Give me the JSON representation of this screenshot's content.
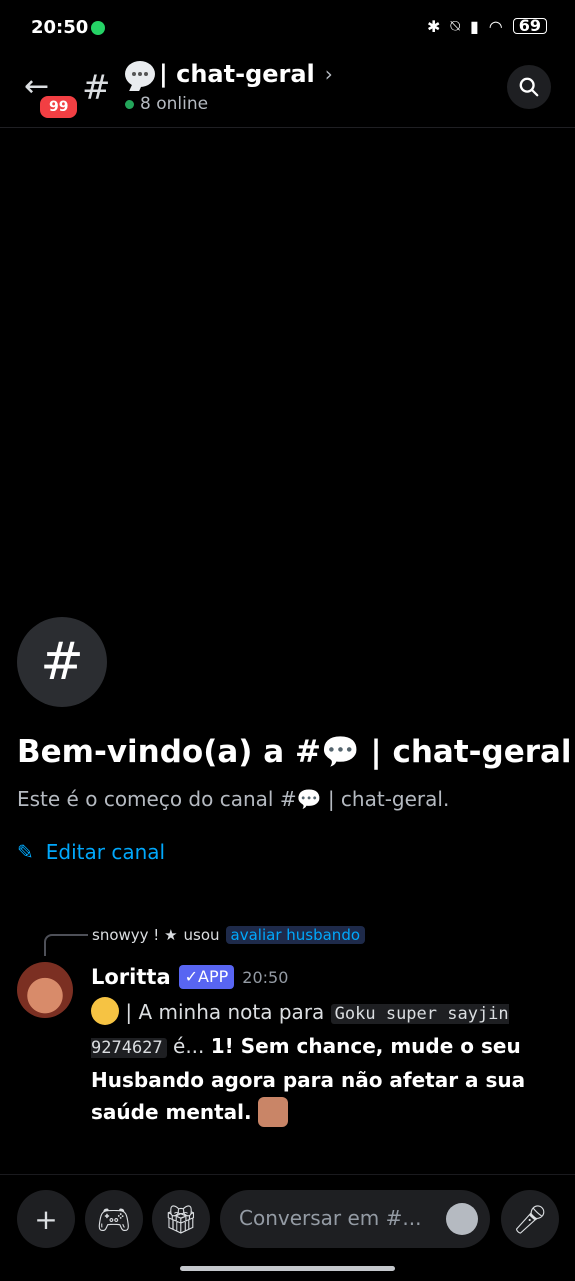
{
  "status_bar": {
    "time": "20:50",
    "battery": "69"
  },
  "header": {
    "back_badge": "99",
    "hash": "#",
    "channel_name": "| chat-geral",
    "online": "8 online"
  },
  "welcome": {
    "icon": "#",
    "title": "Bem-vindo(a) a #💬 | chat-geral!",
    "subtitle": "Este é o começo do canal #💬 | chat-geral.",
    "edit_label": "Editar canal"
  },
  "message": {
    "reply_user": "snowyy ! ★",
    "reply_used": "usou",
    "reply_command": "avaliar husbando",
    "author": "Loritta",
    "app_tag": "✓APP",
    "time": "20:50",
    "text_prefix": "| A minha nota para",
    "code_text": "Goku super sayjin 9274627",
    "text_mid": "é...",
    "text_bold": "1! Sem chance, mude o seu Husbando agora para não afetar a sua saúde mental."
  },
  "composer": {
    "placeholder": "Conversar em #..."
  },
  "icons": [
    "back-arrow-icon",
    "search-icon",
    "pencil-icon",
    "plus-icon",
    "gamepad-icon",
    "gift-icon",
    "emoji-icon",
    "microphone-icon"
  ],
  "colors": {
    "accent_link": "#00a8fc",
    "badge": "#f23f43",
    "app_tag": "#5865f2",
    "online": "#23a55a"
  }
}
